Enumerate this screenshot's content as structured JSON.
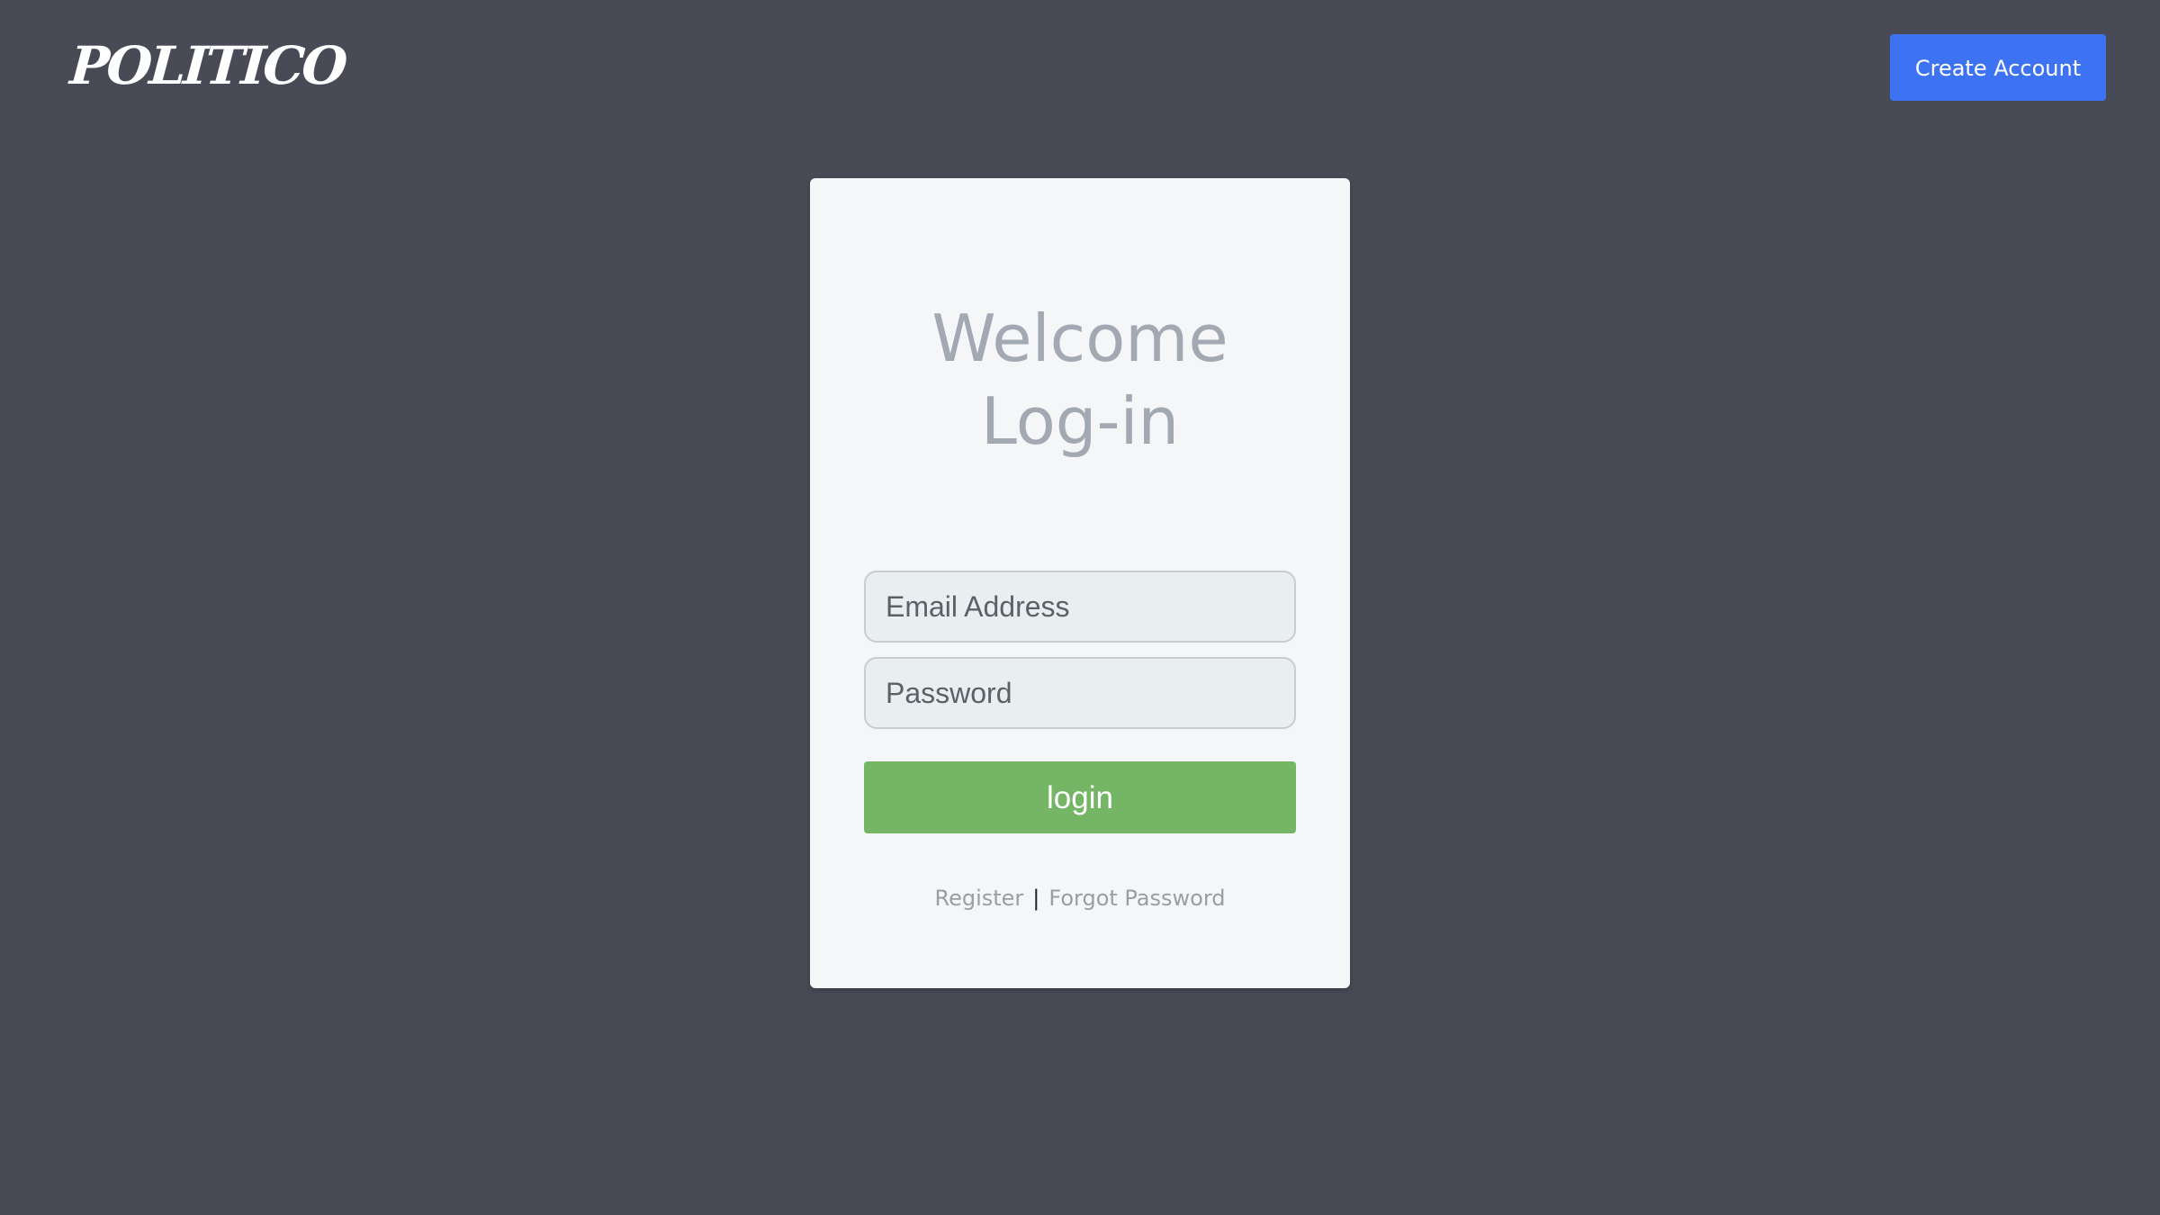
{
  "header": {
    "logo_text": "POLITICO",
    "create_account_label": "Create Account"
  },
  "login_card": {
    "title_line1": "Welcome",
    "title_line2": "Log-in",
    "email_placeholder": "Email Address",
    "password_placeholder": "Password",
    "login_label": "login",
    "register_label": "Register",
    "separator": "|",
    "forgot_password_label": "Forgot Password"
  },
  "colors": {
    "background": "#484a56",
    "card": "#f5f6f7",
    "create_account_button": "#3d73f2",
    "login_button": "#74b566",
    "title_text": "#a2a9b2"
  }
}
